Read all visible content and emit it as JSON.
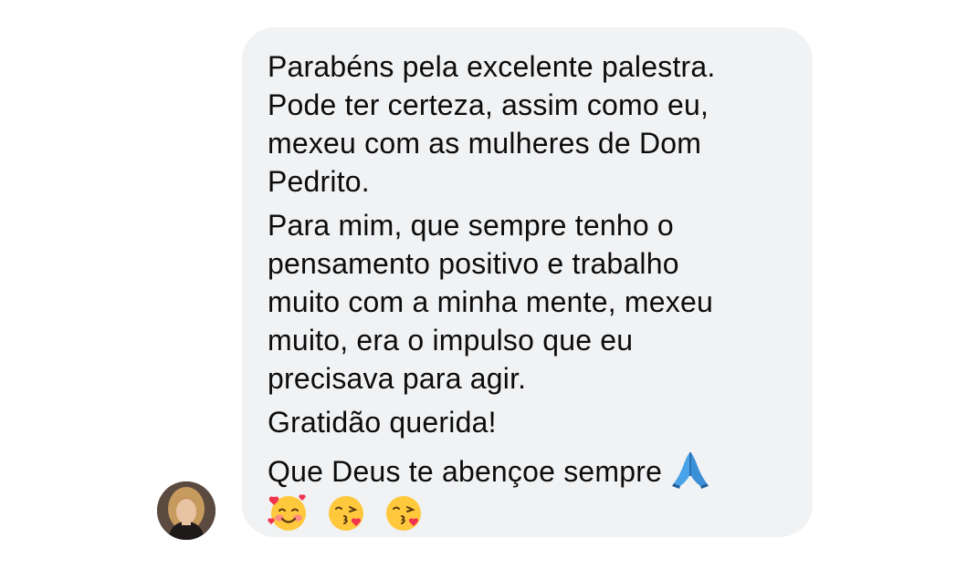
{
  "message": {
    "paragraphs": [
      [
        "Parabéns pela excelente palestra.",
        "Pode ter certeza, assim como eu,",
        "mexeu com as mulheres de Dom",
        "Pedrito."
      ],
      [
        "Para mim, que sempre tenho o",
        "pensamento positivo e trabalho",
        "muito com a minha mente, mexeu",
        "muito, era o impulso que eu",
        "precisava para agir."
      ],
      [
        "Gratidão querida!"
      ],
      [
        "Que Deus te abençoe sempre"
      ]
    ],
    "emojis": {
      "inline_after_last_line": "folded-hands-icon",
      "trailing": [
        "smiling-face-with-hearts-icon",
        "face-blowing-kiss-icon",
        "face-blowing-kiss-icon"
      ]
    },
    "bubble_color": "#f1f2f4",
    "text_color": "#0c0c0c"
  },
  "sender": {
    "avatar_icon": "avatar"
  }
}
